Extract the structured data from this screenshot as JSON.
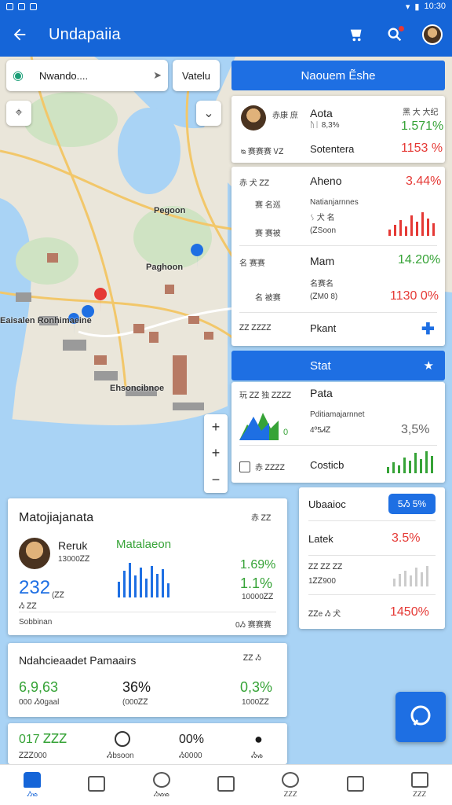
{
  "status_bar": {
    "time": "10:30"
  },
  "app_bar": {
    "title": "Undapaiia"
  },
  "map": {
    "search_text": "Nwando....",
    "filter_label": "Vatelu",
    "labels": [
      "Pegoon",
      "Paghoon",
      "Eaisalen Ronhimaeine",
      "Ehsoncibnoe"
    ]
  },
  "panel1": {
    "header": "Naouem Ẽshe",
    "rows": [
      {
        "left": "赤康 庶",
        "name": "Aota",
        "sub": "ᚢᛁ 8,3%",
        "right_top": "黑 大 大纪",
        "pct": "1.571%",
        "pct_color": "green"
      },
      {
        "left": "ᴓ 赛赛赛 ᏙᏃ",
        "name": "Sotentera",
        "pct": "1153 %",
        "pct_color": "red"
      },
      {
        "left": "赤 犬 ᏃᏃ",
        "name": "Aheno",
        "pct": "3.44%",
        "pct_color": "red"
      },
      {
        "left": "赛 名巡",
        "name": "Natianjarnnes",
        "sub": "ᛊ 犬 名",
        "pct": "",
        "pct_color": "red"
      },
      {
        "left": "赛 赛被",
        "name": "(ᏃSoon",
        "pct": "",
        "pct_color": "red"
      },
      {
        "left": "名 赛赛",
        "name": "Mam",
        "pct": "14.20%",
        "pct_color": "green"
      },
      {
        "left": "名 被赛",
        "name": "(ᏃM0 8)",
        "sub": "名赛名",
        "pct": "1130 0%",
        "pct_color": "red"
      },
      {
        "left": "ᏃᏃ ᏃᏃᏃᏃ",
        "name": "Pkant",
        "pct": "",
        "pct_color": "blue"
      }
    ]
  },
  "panel2": {
    "header": "Stat",
    "title_row": "玩 ᏃᏃ 独 ᏃᏃᏃᏃ",
    "name": "Pata",
    "sub_name": "Pditiamajarnnet",
    "sub_value": "4º5ᏗᏃ",
    "pct": "3,5%",
    "row2_left": "赤 ᏃᏃᏃᏃ",
    "row2_name": "Costicb",
    "mark": "0"
  },
  "panel3": {
    "badge": "5Ᏹ 5%",
    "rows": [
      {
        "name": "Ubaaioc"
      },
      {
        "name": "Latek",
        "pct": "3.5%",
        "pct_color": "red"
      },
      {
        "name": "ᏃᏃ ᏃᏃ ᏃᏃ",
        "sub": "1ᏃᏃ900"
      },
      {
        "name": "ᏃᏃe Ᏹ 犬",
        "pct": "1450%",
        "pct_color": "red"
      }
    ]
  },
  "card_main": {
    "title": "Matojiajanata",
    "corner": "赤 ᏃᏃ",
    "user_name": "Reruk",
    "user_sub": "13000ᏃᏃ",
    "brand": "Matalaeon",
    "big_number": "232",
    "big_unit": "(ᏃᏃ",
    "big_sub": "Ᏹ ᏃᏃ",
    "pct1": "1.69%",
    "pct2": "1.1%",
    "pct_sub": "10000ᏃᏃ",
    "footer_left": "Sobbinan",
    "footer_right": "0Ᏹ 赛赛赛"
  },
  "card_stats": {
    "title": "Ndahcieaadet Pamaairs",
    "corner": "ᏃᏃ Ᏹ",
    "stats": [
      {
        "value": "6,9,63",
        "label": "000 Ᏹ0gaal",
        "color": "green"
      },
      {
        "value": "36%",
        "label": "(000ᏃᏃ",
        "color": "dark"
      },
      {
        "value": "0,3%",
        "label": "1000ᏃᏃ",
        "color": "green"
      }
    ]
  },
  "card_quick": {
    "items": [
      {
        "value": "017 ᏃᏃᏃ",
        "label": "ᏃᏃᏃ000"
      },
      {
        "value": "",
        "label": "Ᏹbsoon"
      },
      {
        "value": "00%",
        "label": "Ᏹ0000"
      },
      {
        "value": "",
        "label": "Ᏹᏹ"
      }
    ]
  },
  "bottom_nav": [
    {
      "label": "Ᏹᏹ",
      "active": true
    },
    {
      "label": ""
    },
    {
      "label": "Ᏹᏹᏹ"
    },
    {
      "label": ""
    },
    {
      "label": "ᏃᏃᏃ"
    },
    {
      "label": ""
    },
    {
      "label": "ᏃᏃᏃ"
    }
  ]
}
